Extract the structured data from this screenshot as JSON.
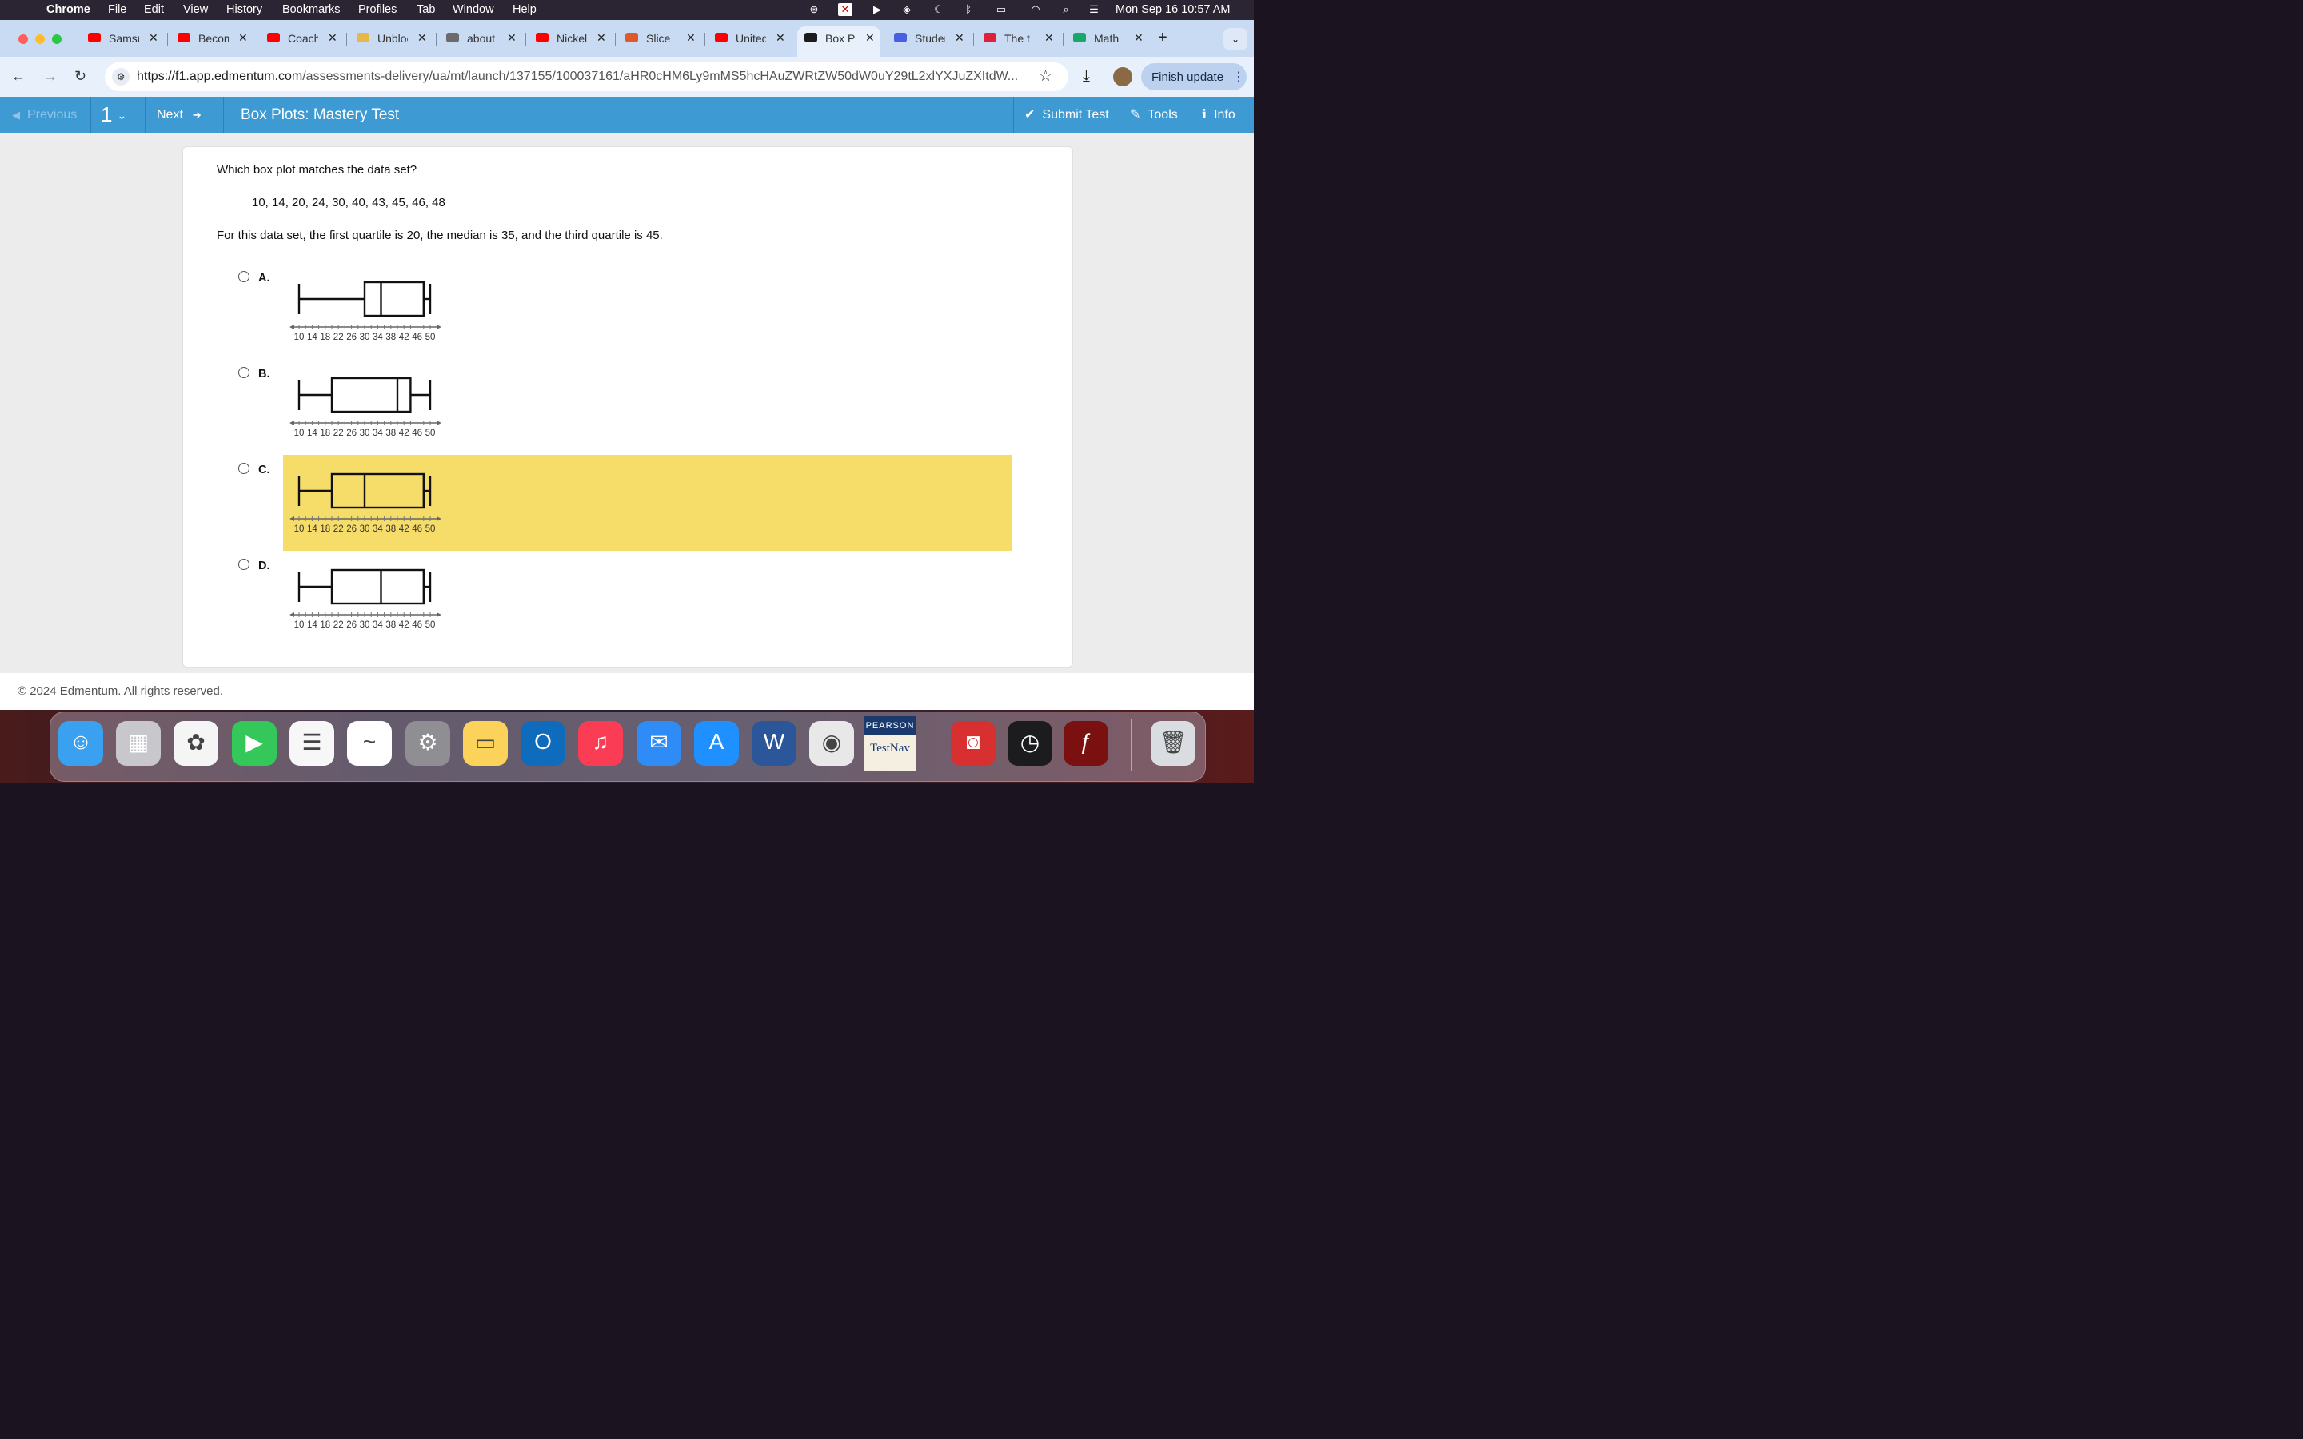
{
  "menubar": {
    "app": "Chrome",
    "items": [
      "File",
      "Edit",
      "View",
      "History",
      "Bookmarks",
      "Profiles",
      "Tab",
      "Window",
      "Help"
    ],
    "clock": "Mon Sep 16  10:57 AM"
  },
  "tabs": [
    {
      "label": "Samsung",
      "favicon_color": "#ff0000"
    },
    {
      "label": "Become",
      "favicon_color": "#ff0000"
    },
    {
      "label": "Coach",
      "favicon_color": "#ff0000"
    },
    {
      "label": "Unblocked",
      "favicon_color": "#e8b74a"
    },
    {
      "label": "about",
      "favicon_color": "#6b6b6b"
    },
    {
      "label": "Nickel",
      "favicon_color": "#ff0000"
    },
    {
      "label": "Slice",
      "favicon_color": "#e0592a"
    },
    {
      "label": "United",
      "favicon_color": "#ff0000"
    },
    {
      "label": "Box P",
      "favicon_color": "#1c1c1c"
    },
    {
      "label": "Student",
      "favicon_color": "#4a5fe0"
    },
    {
      "label": "The t",
      "favicon_color": "#e0203a"
    },
    {
      "label": "Math",
      "favicon_color": "#17a86a"
    }
  ],
  "address": {
    "url_host": "https://f1.app.edmentum.com",
    "url_path": "/assessments-delivery/ua/mt/launch/137155/100037161/aHR0cHM6Ly9mMS5hcHAuZWRtZW50dW0uY29tL2xlYXJuZXItdW...",
    "finish_update": "Finish update"
  },
  "appbar": {
    "previous": "Previous",
    "question_number": "1",
    "next": "Next",
    "title": "Box Plots: Mastery Test",
    "submit": "Submit Test",
    "tools": "Tools",
    "info": "Info"
  },
  "question": {
    "prompt": "Which box plot matches the data set?",
    "data_set": "10, 14, 20, 24, 30, 40, 43, 45, 46, 48",
    "note": "For this data set, the first quartile is 20, the median is 35, and the third quartile is 45."
  },
  "options": [
    {
      "letter": "A.",
      "min": 10,
      "q1": 30,
      "median": 35,
      "q3": 48,
      "max": 50
    },
    {
      "letter": "B.",
      "min": 10,
      "q1": 20,
      "median": 40,
      "q3": 44,
      "max": 50
    },
    {
      "letter": "C.",
      "min": 10,
      "q1": 20,
      "median": 30,
      "q3": 48,
      "max": 50
    },
    {
      "letter": "D.",
      "min": 10,
      "q1": 20,
      "median": 35,
      "q3": 48,
      "max": 50
    }
  ],
  "axis": {
    "min": 10,
    "max": 50,
    "tick_labels": [
      "10",
      "14",
      "18",
      "22",
      "26",
      "30",
      "34",
      "38",
      "42",
      "46",
      "50"
    ]
  },
  "footer": "© 2024 Edmentum. All rights reserved.",
  "dock": [
    {
      "name": "finder-icon",
      "color": "#3aa0f0",
      "glyph": "☺"
    },
    {
      "name": "launchpad-icon",
      "color": "#c7c7cc",
      "glyph": "▦"
    },
    {
      "name": "photos-icon",
      "color": "#f5f5f5",
      "glyph": "✿"
    },
    {
      "name": "facetime-icon",
      "color": "#34c759",
      "glyph": "▶"
    },
    {
      "name": "reminders-icon",
      "color": "#f7f7f7",
      "glyph": "☰"
    },
    {
      "name": "freeform-icon",
      "color": "#ffffff",
      "glyph": "~"
    },
    {
      "name": "system-settings-icon",
      "color": "#8e8e93",
      "glyph": "⚙"
    },
    {
      "name": "notes-icon",
      "color": "#fbd35a",
      "glyph": "▭"
    },
    {
      "name": "outlook-icon",
      "color": "#0f6cbd",
      "glyph": "O"
    },
    {
      "name": "music-icon",
      "color": "#fa3d55",
      "glyph": "♫"
    },
    {
      "name": "mail-icon",
      "color": "#2f8cf7",
      "glyph": "✉"
    },
    {
      "name": "app-store-icon",
      "color": "#1e90ff",
      "glyph": "A"
    },
    {
      "name": "word-icon",
      "color": "#2b579a",
      "glyph": "W"
    },
    {
      "name": "chrome-icon",
      "color": "#e8e8e8",
      "glyph": "◉"
    },
    {
      "name": "testnav-icon",
      "color": "#f4efe1",
      "glyph": ""
    },
    {
      "name": "photo-booth-icon",
      "color": "#d83030",
      "glyph": "◙"
    },
    {
      "name": "clock-icon",
      "color": "#1c1c1e",
      "glyph": "◷"
    },
    {
      "name": "flash-icon",
      "color": "#7a1010",
      "glyph": "ƒ"
    },
    {
      "name": "trash-icon",
      "color": "#d9dde2",
      "glyph": "🗑"
    }
  ],
  "testnav": {
    "brand": "PEARSON",
    "name": "TestNav"
  }
}
